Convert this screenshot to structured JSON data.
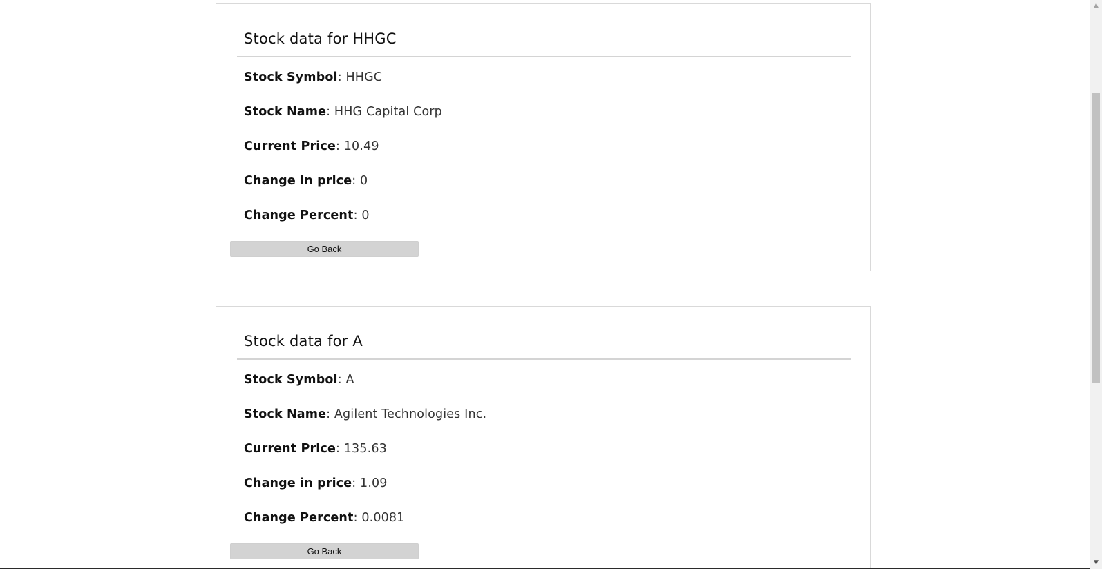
{
  "cards": [
    {
      "title": "Stock data for HHGC",
      "fields": [
        {
          "label": "Stock Symbol",
          "value": "HHGC"
        },
        {
          "label": "Stock Name",
          "value": "HHG Capital Corp"
        },
        {
          "label": "Current Price",
          "value": "10.49"
        },
        {
          "label": "Change in price",
          "value": "0"
        },
        {
          "label": "Change Percent",
          "value": "0"
        }
      ],
      "button_label": "Go Back"
    },
    {
      "title": "Stock data for A",
      "fields": [
        {
          "label": "Stock Symbol",
          "value": "A"
        },
        {
          "label": "Stock Name",
          "value": "Agilent Technologies Inc."
        },
        {
          "label": "Current Price",
          "value": "135.63"
        },
        {
          "label": "Change in price",
          "value": "1.09"
        },
        {
          "label": "Change Percent",
          "value": "0.0081"
        }
      ],
      "button_label": "Go Back"
    }
  ],
  "separator": ": ",
  "scrollbar": {
    "up_icon": "▲",
    "down_icon": "▼"
  }
}
